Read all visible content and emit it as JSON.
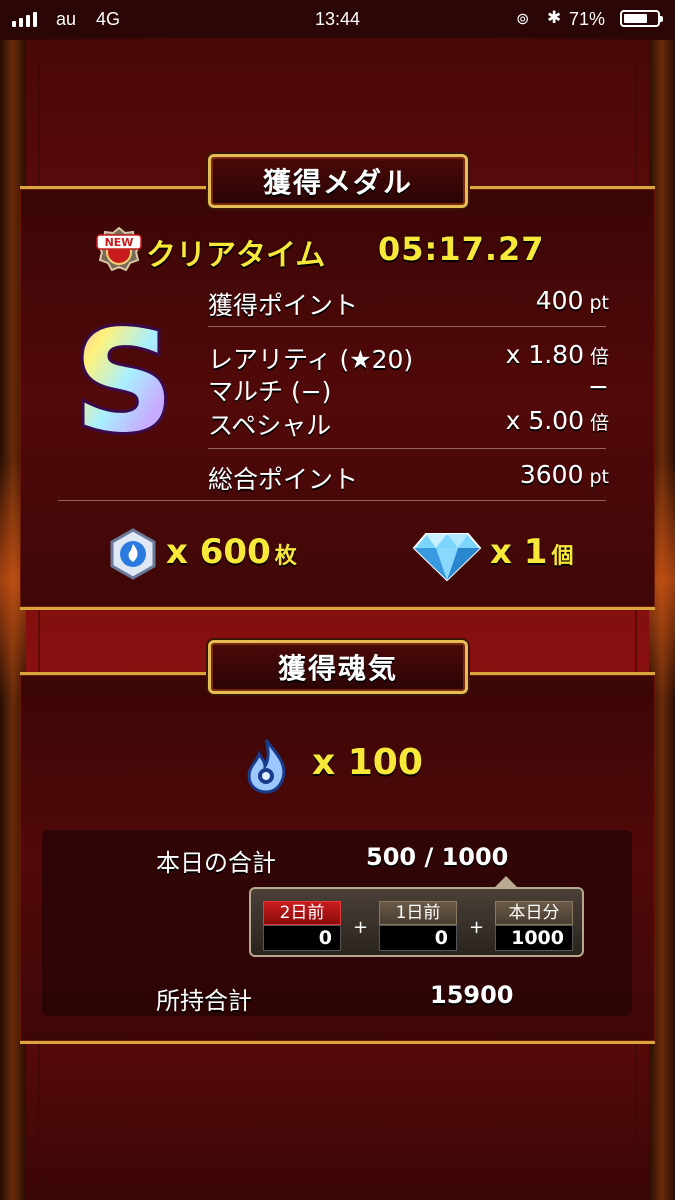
{
  "status_bar": {
    "carrier": "au",
    "network": "4G",
    "time": "13:44",
    "battery_pct": "71%",
    "battery_level": 0.71
  },
  "medal_panel": {
    "title": "獲得メダル",
    "new_badge": "NEW",
    "clear_label": "クリアタイム",
    "clear_time": "05:17.27",
    "rank": "S",
    "rows": [
      {
        "label": "獲得ポイント",
        "value": "400",
        "unit": "pt"
      },
      {
        "label": "レアリティ (★20)",
        "value": "x 1.80",
        "unit": "倍"
      },
      {
        "label": "マルチ (−)",
        "value": "−",
        "unit": ""
      },
      {
        "label": "スペシャル",
        "value": "x 5.00",
        "unit": "倍"
      }
    ],
    "total": {
      "label": "総合ポイント",
      "value": "3600",
      "unit": "pt"
    },
    "rewards": [
      {
        "icon": "medal-icon",
        "amount": "x 600",
        "unit": "枚"
      },
      {
        "icon": "diamond-icon",
        "amount": "x 1",
        "unit": "個"
      }
    ]
  },
  "soul_panel": {
    "title": "獲得魂気",
    "soul_amount": "x 100",
    "today_label": "本日の合計",
    "today_value": "500 / 1000",
    "days": [
      {
        "label": "2日前",
        "value": "0"
      },
      {
        "label": "1日前",
        "value": "0"
      },
      {
        "label": "本日分",
        "value": "1000"
      }
    ],
    "plus": "+",
    "owned_label": "所持合計",
    "owned_value": "15900"
  }
}
